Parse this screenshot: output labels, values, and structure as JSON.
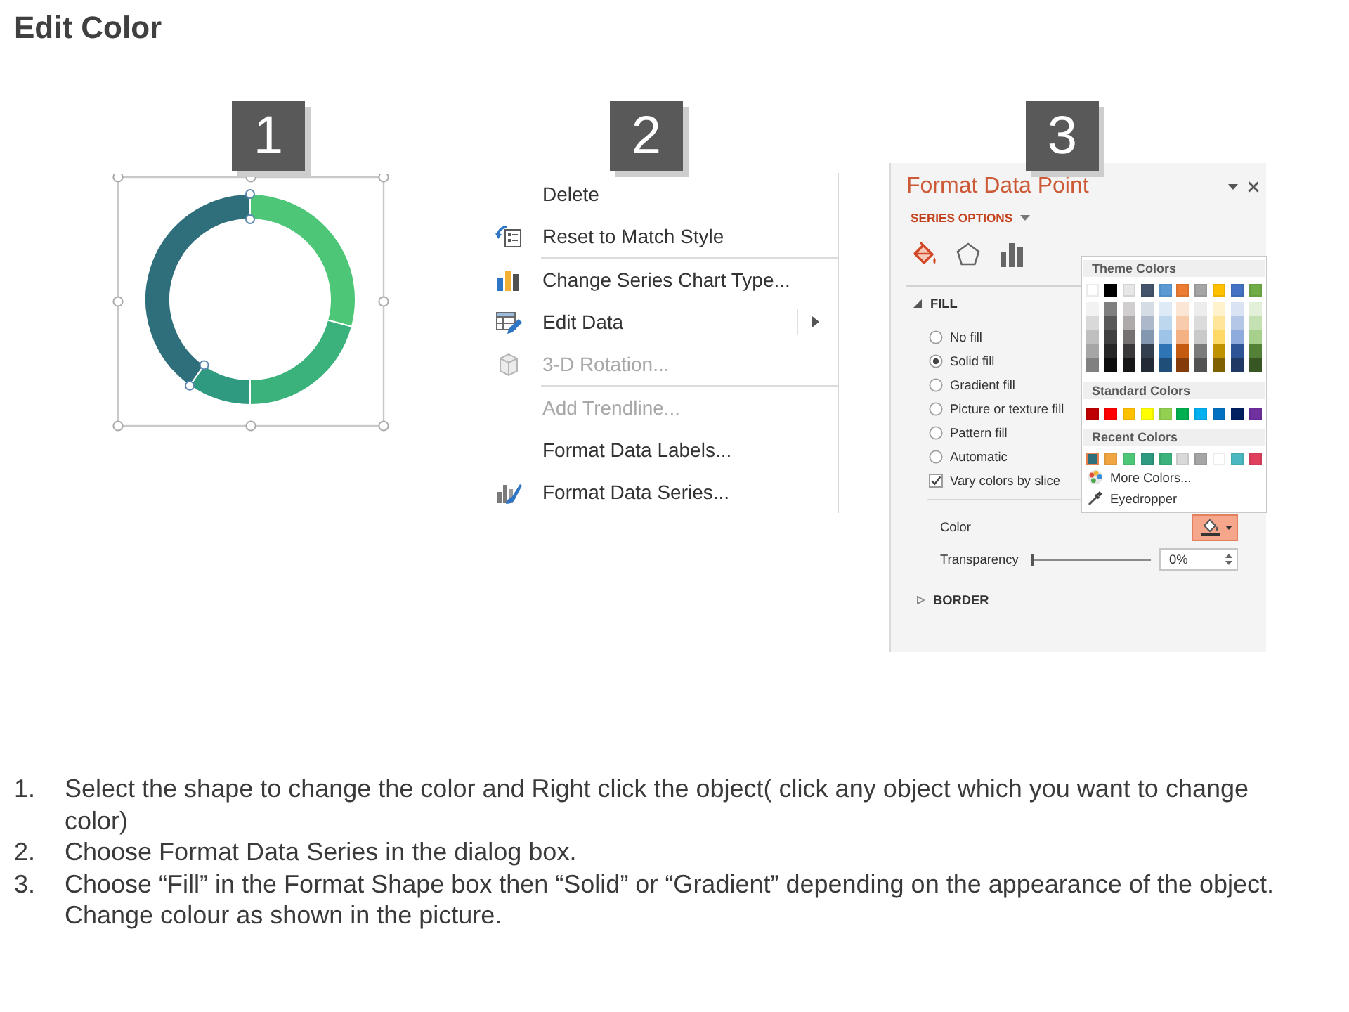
{
  "title": "Edit Color",
  "steps": [
    {
      "badge": "1"
    },
    {
      "badge": "2"
    },
    {
      "badge": "3"
    }
  ],
  "donut_chart": {
    "selected": true,
    "slices": [
      {
        "color": "#4dc777",
        "selected": false
      },
      {
        "color": "#3bb27b",
        "selected": false
      },
      {
        "color": "#2f9a80",
        "selected": false
      },
      {
        "color": "#2f6f7b",
        "selected": true
      }
    ]
  },
  "context_menu": {
    "items": [
      {
        "kind": "plain",
        "label": "Delete",
        "disabled": false,
        "submenu": false,
        "separator_after": false
      },
      {
        "kind": "reset",
        "label": "Reset to Match Style",
        "disabled": false,
        "submenu": false,
        "separator_after": true
      },
      {
        "kind": "charttype",
        "label": "Change Series Chart Type...",
        "disabled": false,
        "submenu": false,
        "separator_after": false
      },
      {
        "kind": "editdata",
        "label": "Edit Data",
        "disabled": false,
        "submenu": true,
        "separator_after": false
      },
      {
        "kind": "rotation",
        "label": "3-D Rotation...",
        "disabled": true,
        "submenu": false,
        "separator_after": true
      },
      {
        "kind": "plain",
        "label": "Add Trendline...",
        "disabled": true,
        "submenu": false,
        "separator_after": false
      },
      {
        "kind": "plain",
        "label": "Format Data Labels...",
        "disabled": false,
        "submenu": false,
        "separator_after": false
      },
      {
        "kind": "series",
        "label": "Format Data Series...",
        "disabled": false,
        "submenu": false,
        "separator_after": false
      }
    ]
  },
  "format_pane": {
    "title": "Format Data Point",
    "options_menu": "SERIES OPTIONS",
    "tabs": [
      {
        "kind": "fill",
        "selected": true
      },
      {
        "kind": "effects",
        "selected": false
      },
      {
        "kind": "options",
        "selected": false
      }
    ],
    "fill_section": {
      "label": "FILL",
      "expanded": true
    },
    "fill_options": [
      {
        "label": "No fill",
        "selected": false
      },
      {
        "label": "Solid fill",
        "selected": true
      },
      {
        "label": "Gradient fill",
        "selected": false
      },
      {
        "label": "Picture or texture fill",
        "selected": false
      },
      {
        "label": "Pattern fill",
        "selected": false
      },
      {
        "label": "Automatic",
        "selected": false
      }
    ],
    "vary_colors": {
      "label": "Vary colors by slice",
      "checked": true
    },
    "color": {
      "label": "Color",
      "open": true,
      "picker": {
        "theme_heading": "Theme Colors",
        "theme_colors": [
          {
            "color": "#ffffff",
            "shades": [
              {
                "color": "#f2f2f2"
              },
              {
                "color": "#d9d9d9"
              },
              {
                "color": "#bfbfbf"
              },
              {
                "color": "#a6a6a6"
              },
              {
                "color": "#808080"
              }
            ]
          },
          {
            "color": "#000000",
            "shades": [
              {
                "color": "#7f7f7f"
              },
              {
                "color": "#595959"
              },
              {
                "color": "#404040"
              },
              {
                "color": "#262626"
              },
              {
                "color": "#0d0d0d"
              }
            ]
          },
          {
            "color": "#e7e6e6",
            "shades": [
              {
                "color": "#d0cece"
              },
              {
                "color": "#aeaaaa"
              },
              {
                "color": "#757171"
              },
              {
                "color": "#3a3838"
              },
              {
                "color": "#171616"
              }
            ]
          },
          {
            "color": "#44546a",
            "shades": [
              {
                "color": "#d6dce4"
              },
              {
                "color": "#adb9ca"
              },
              {
                "color": "#8497b0"
              },
              {
                "color": "#333f4f"
              },
              {
                "color": "#222a35"
              }
            ]
          },
          {
            "color": "#5b9bd5",
            "shades": [
              {
                "color": "#deebf6"
              },
              {
                "color": "#bdd7ee"
              },
              {
                "color": "#9dc3e6"
              },
              {
                "color": "#2e75b5"
              },
              {
                "color": "#1f4e79"
              }
            ]
          },
          {
            "color": "#ed7d31",
            "shades": [
              {
                "color": "#fbe5d5"
              },
              {
                "color": "#f7cbac"
              },
              {
                "color": "#f4b183"
              },
              {
                "color": "#c55a11"
              },
              {
                "color": "#843c0b"
              }
            ]
          },
          {
            "color": "#a5a5a5",
            "shades": [
              {
                "color": "#ededed"
              },
              {
                "color": "#dbdbdb"
              },
              {
                "color": "#c9c9c9"
              },
              {
                "color": "#7b7b7b"
              },
              {
                "color": "#525252"
              }
            ]
          },
          {
            "color": "#ffc000",
            "shades": [
              {
                "color": "#fff2cc"
              },
              {
                "color": "#fee599"
              },
              {
                "color": "#ffd965"
              },
              {
                "color": "#bf9000"
              },
              {
                "color": "#7f6000"
              }
            ]
          },
          {
            "color": "#4472c4",
            "shades": [
              {
                "color": "#dae3f3"
              },
              {
                "color": "#b4c7e7"
              },
              {
                "color": "#8faadc"
              },
              {
                "color": "#2f5496"
              },
              {
                "color": "#1f3864"
              }
            ]
          },
          {
            "color": "#70ad47",
            "shades": [
              {
                "color": "#e2efd9"
              },
              {
                "color": "#c5e0b3"
              },
              {
                "color": "#a8d08d"
              },
              {
                "color": "#538135"
              },
              {
                "color": "#375623"
              }
            ]
          }
        ],
        "standard_heading": "Standard Colors",
        "standard_colors": [
          {
            "color": "#c00000"
          },
          {
            "color": "#ff0000"
          },
          {
            "color": "#ffc000"
          },
          {
            "color": "#ffff00"
          },
          {
            "color": "#92d050"
          },
          {
            "color": "#00b050"
          },
          {
            "color": "#00b0f0"
          },
          {
            "color": "#0070c0"
          },
          {
            "color": "#002060"
          },
          {
            "color": "#7030a0"
          }
        ],
        "recent_heading": "Recent Colors",
        "recent_colors": [
          {
            "color": "#2f6f7b",
            "selected": true
          },
          {
            "color": "#f0a540",
            "selected": false
          },
          {
            "color": "#4dc777",
            "selected": false
          },
          {
            "color": "#2f9a80",
            "selected": false
          },
          {
            "color": "#3bb27b",
            "selected": false
          },
          {
            "color": "#d9d9d9",
            "selected": false
          },
          {
            "color": "#a5a5a5",
            "selected": false
          },
          {
            "color": "#ffffff",
            "selected": false
          },
          {
            "color": "#4bb8c0",
            "selected": false
          },
          {
            "color": "#e0405e",
            "selected": false
          }
        ],
        "more_colors": "More Colors...",
        "eyedropper": "Eyedropper"
      }
    },
    "transparency": {
      "label": "Transparency",
      "level": 0,
      "value": "0%"
    },
    "border_section": {
      "label": "BORDER",
      "expanded": false
    }
  },
  "instructions": [
    {
      "number": "1.",
      "text": "Select the shape to change the color and Right click the object( click any object which you want to change color)"
    },
    {
      "number": "2.",
      "text": "Choose Format Data Series in the dialog box."
    },
    {
      "number": "3.",
      "text": "Choose “Fill” in the Format Shape box then “Solid” or “Gradient” depending on the appearance of the object. Change colour as shown in the picture."
    }
  ]
}
